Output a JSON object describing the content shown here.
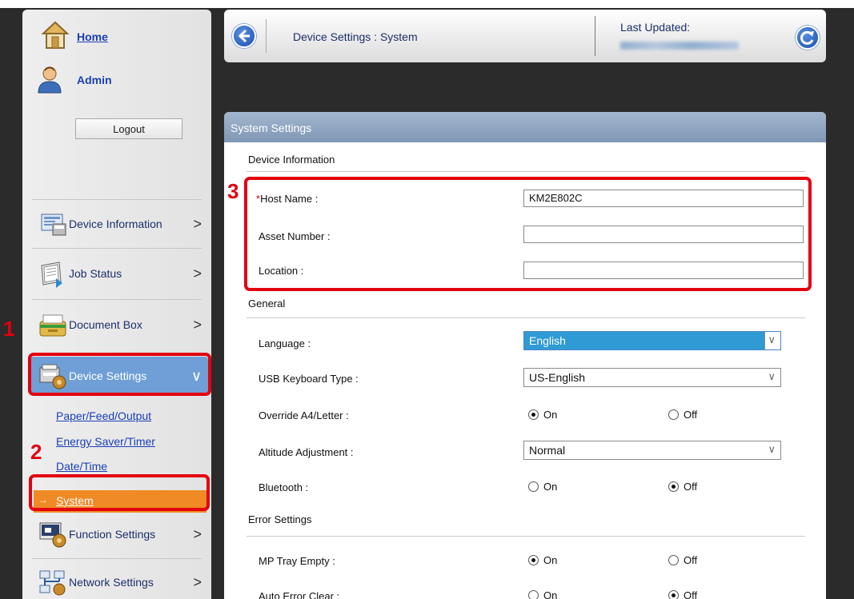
{
  "sidebar": {
    "home_label": "Home",
    "user_label": "Admin",
    "logout_label": "Logout",
    "nav_items": [
      {
        "label": "Device Information",
        "icon": "device-information-icon"
      },
      {
        "label": "Job Status",
        "icon": "job-status-icon"
      },
      {
        "label": "Document Box",
        "icon": "document-box-icon"
      },
      {
        "label": "Device Settings",
        "icon": "device-settings-icon",
        "active": true
      },
      {
        "label": "Function Settings",
        "icon": "function-settings-icon"
      },
      {
        "label": "Network Settings",
        "icon": "network-settings-icon"
      }
    ],
    "sub_items": [
      "Paper/Feed/Output",
      "Energy Saver/Timer",
      "Date/Time",
      "System"
    ]
  },
  "header": {
    "breadcrumb": "Device Settings : System",
    "last_updated_label": "Last Updated:"
  },
  "steps": {
    "one": "1",
    "two": "2",
    "three": "3"
  },
  "panel": {
    "title": "System Settings",
    "device_information": {
      "section": "Device Information",
      "required_mark": "*",
      "host_name_label": "Host Name :",
      "host_name_value": "KM2E802C",
      "asset_number_label": "Asset Number :",
      "asset_number_value": "",
      "location_label": "Location :",
      "location_value": ""
    },
    "general": {
      "section": "General",
      "language_label": "Language :",
      "language_value": "English",
      "usb_keyboard_label": "USB Keyboard Type :",
      "usb_keyboard_value": "US-English",
      "override_label": "Override A4/Letter :",
      "override_selected": "On",
      "altitude_label": "Altitude Adjustment :",
      "altitude_value": "Normal",
      "bluetooth_label": "Bluetooth :",
      "bluetooth_selected": "Off"
    },
    "error": {
      "section": "Error Settings",
      "mp_tray_label": "MP Tray Empty :",
      "mp_tray_selected": "On",
      "auto_error_label": "Auto Error Clear :",
      "auto_error_selected": "Off"
    },
    "options": {
      "on": "On",
      "off": "Off"
    }
  },
  "colors": {
    "highlight": "#e3000f",
    "active_nav": "#6f9fd6",
    "active_sub": "#ef8a25",
    "link": "#1a3fb5"
  }
}
